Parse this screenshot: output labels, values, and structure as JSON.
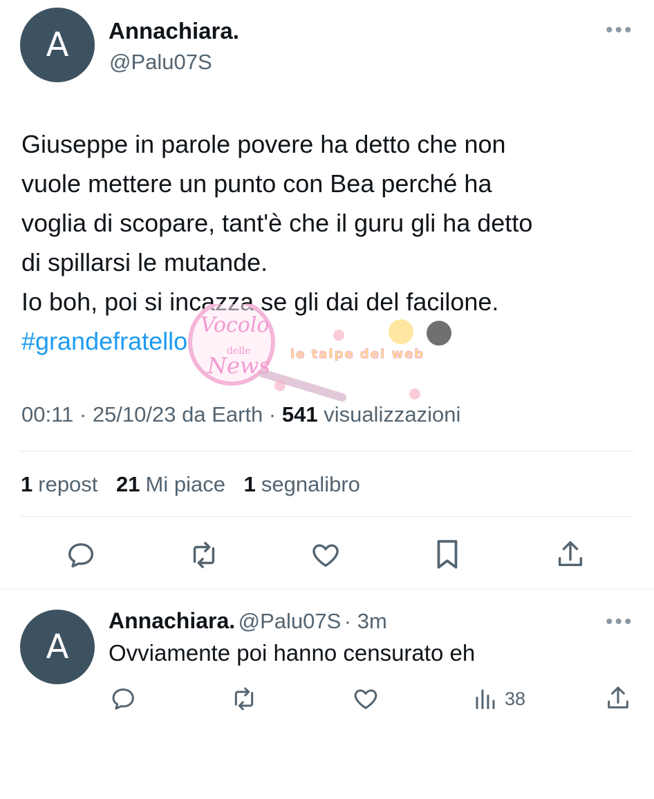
{
  "tweet": {
    "avatar_letter": "A",
    "display_name": "Annachiara.",
    "handle": "@Palu07S",
    "more_label": "•••",
    "text_lines": [
      "Giuseppe in parole povere ha detto che non",
      "vuole mettere un punto con Bea perché ha",
      "voglia di scopare, tant'è che il guru gli ha detto",
      "di spillarsi le mutande.",
      "Io boh, poi si incazza se gli dai del facilone."
    ],
    "hashtag": "#grandefratello",
    "meta_prefix": "00:11 · 25/10/23 da Earth · ",
    "views_count": "541",
    "views_label": " visualizzazioni",
    "stats": {
      "reposts_count": "1",
      "reposts_label": "repost",
      "likes_count": "21",
      "likes_label": "Mi piace",
      "bookmarks_count": "1",
      "bookmarks_label": "segnalibro"
    },
    "actions": [
      "reply-icon",
      "retweet-icon",
      "heart-icon",
      "bookmark-icon",
      "share-icon"
    ]
  },
  "reply": {
    "avatar_letter": "A",
    "display_name": "Annachiara.",
    "handle": "@Palu07S",
    "time": "· 3m",
    "more_label": "•••",
    "text": "Ovviamente poi hanno censurato eh",
    "views": "38",
    "actions": [
      "reply-icon",
      "retweet-icon",
      "heart-icon",
      "views-icon",
      "share-icon"
    ]
  },
  "watermark": {
    "script_text_1": "Vocolo",
    "script_text_2": "delle",
    "script_text_3": "News",
    "banner_text": "le talpe del web"
  },
  "colors": {
    "text": "#0f1419",
    "secondary": "#536471",
    "link": "#1d9bf0",
    "avatar": "#3d5260",
    "divider": "#e6e9eb"
  }
}
